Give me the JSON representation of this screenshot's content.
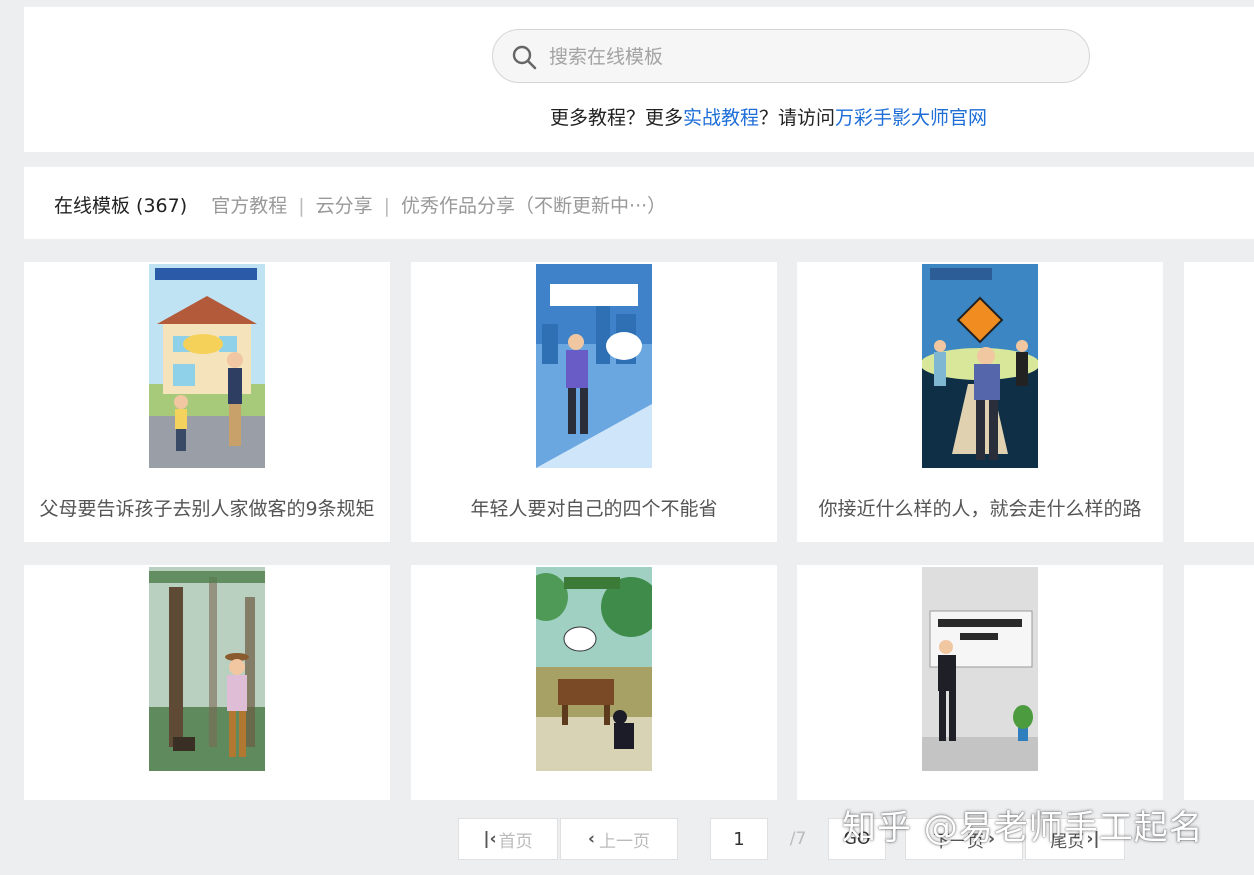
{
  "search": {
    "placeholder": "搜索在线模板"
  },
  "promo": {
    "part1": "更多教程？更多",
    "link1": "实战教程",
    "part2": "？请访问",
    "link2": "万彩手影大师官网"
  },
  "tabs": {
    "active": "在线模板 (367)",
    "items": [
      "官方教程",
      "云分享",
      "优秀作品分享（不断更新中···）"
    ],
    "separator": "|"
  },
  "cards": [
    {
      "title": "父母要告诉孩子去别人家做客的9条规矩"
    },
    {
      "title": "年轻人要对自己的四个不能省"
    },
    {
      "title": "你接近什么样的人，就会走什么样的路"
    }
  ],
  "pagination": {
    "first": "首页",
    "prev": "上一页",
    "current": "1",
    "total": "/7",
    "go": "GO",
    "next": "下一页",
    "last": "尾页"
  },
  "watermark": "知乎 @易老师手工起名",
  "colors": {
    "link": "#1e6ed8",
    "background": "#edeef0"
  }
}
